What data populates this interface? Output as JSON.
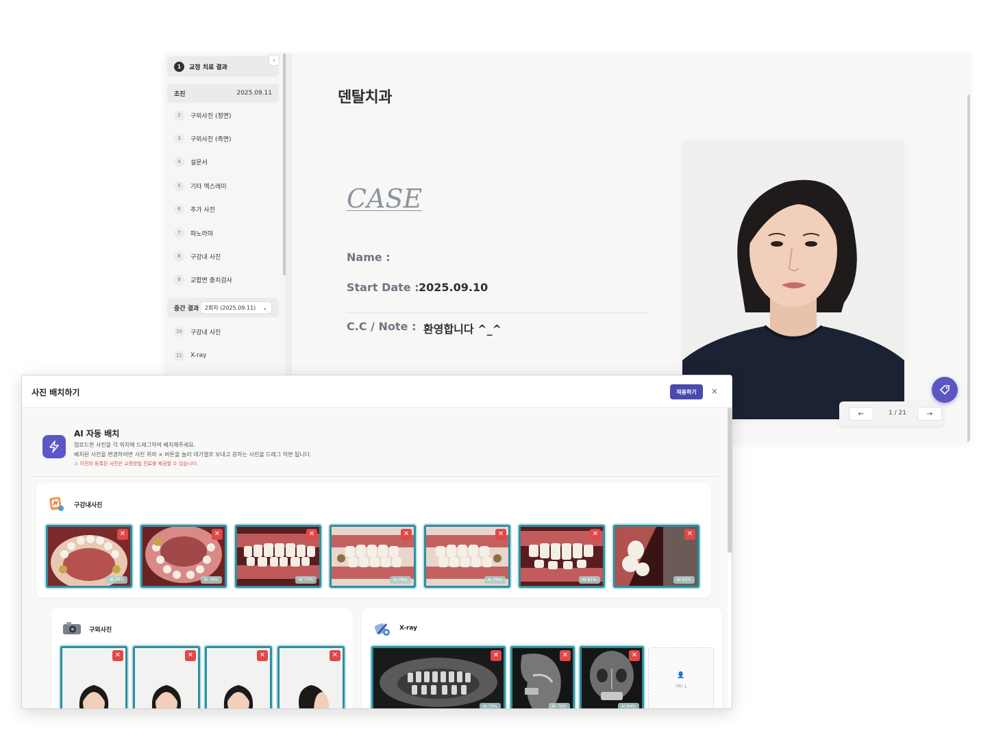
{
  "sidebar": {
    "header_num": "1",
    "header_label": "교정 치료 결과",
    "collapse_icon": "‹",
    "section1": {
      "label": "초진",
      "date": "2025.09.11"
    },
    "items1": [
      {
        "num": "2",
        "label": "구외사진 (정면)"
      },
      {
        "num": "3",
        "label": "구외사진 (측면)"
      },
      {
        "num": "4",
        "label": "설문서"
      },
      {
        "num": "5",
        "label": "기타 엑스레이"
      },
      {
        "num": "6",
        "label": "추가 사진"
      },
      {
        "num": "7",
        "label": "파노라마"
      },
      {
        "num": "8",
        "label": "구강내 사진"
      },
      {
        "num": "9",
        "label": "교합면 충치검사"
      }
    ],
    "section2": {
      "label": "중간 결과",
      "select_value": "2회차 (2025.09.11)"
    },
    "items2": [
      {
        "num": "10",
        "label": "구강내 사진"
      },
      {
        "num": "11",
        "label": "X-ray"
      }
    ]
  },
  "main": {
    "clinic_name": "덴탈치과",
    "case_title": "CASE",
    "name_label": "Name :",
    "start_label": "Start Date :",
    "start_value": "2025.09.10",
    "note_label": "C.C / Note :",
    "note_value": "환영합니다 ^_^",
    "pager": {
      "prev": "←",
      "next": "→",
      "page_text": "1 / 21"
    }
  },
  "modal": {
    "title": "사진 배치하기",
    "apply_label": "적용하기",
    "close_label": "×",
    "ai": {
      "title": "AI 자동 배치",
      "desc1": "업로드한 사진을 각 위치에 드래그하여 배치해주세요.",
      "desc2": "배치된 사진을 변경하려면 사진 위의 × 버튼을 눌러 대기열로 보내고 원하는 사진을 드래그 하면 됩니다.",
      "warning": "⚠ 이전의 등록된 사진은 교정방법 진료를 제공할 수 있습니다."
    },
    "intraoral": {
      "title": "구강내사진",
      "photos": [
        {
          "badge": "AI 74%"
        },
        {
          "badge": "AI 78%"
        },
        {
          "badge": "AI 73%"
        },
        {
          "badge": "AI 78%"
        },
        {
          "badge": "AI 79%"
        },
        {
          "badge": "AI 81%"
        },
        {
          "badge": "AI 83%"
        }
      ]
    },
    "extraoral": {
      "title": "구외사진"
    },
    "xray": {
      "title": "X-ray",
      "photos": [
        {
          "badge": "AI 70%"
        },
        {
          "badge": "AI 79%"
        },
        {
          "badge": "AI 84%"
        }
      ],
      "empty_label": "기타 1"
    }
  },
  "colors": {
    "accent": "#4a49b0",
    "thumb_border": "#2e8ea0",
    "remove": "#e04848"
  }
}
